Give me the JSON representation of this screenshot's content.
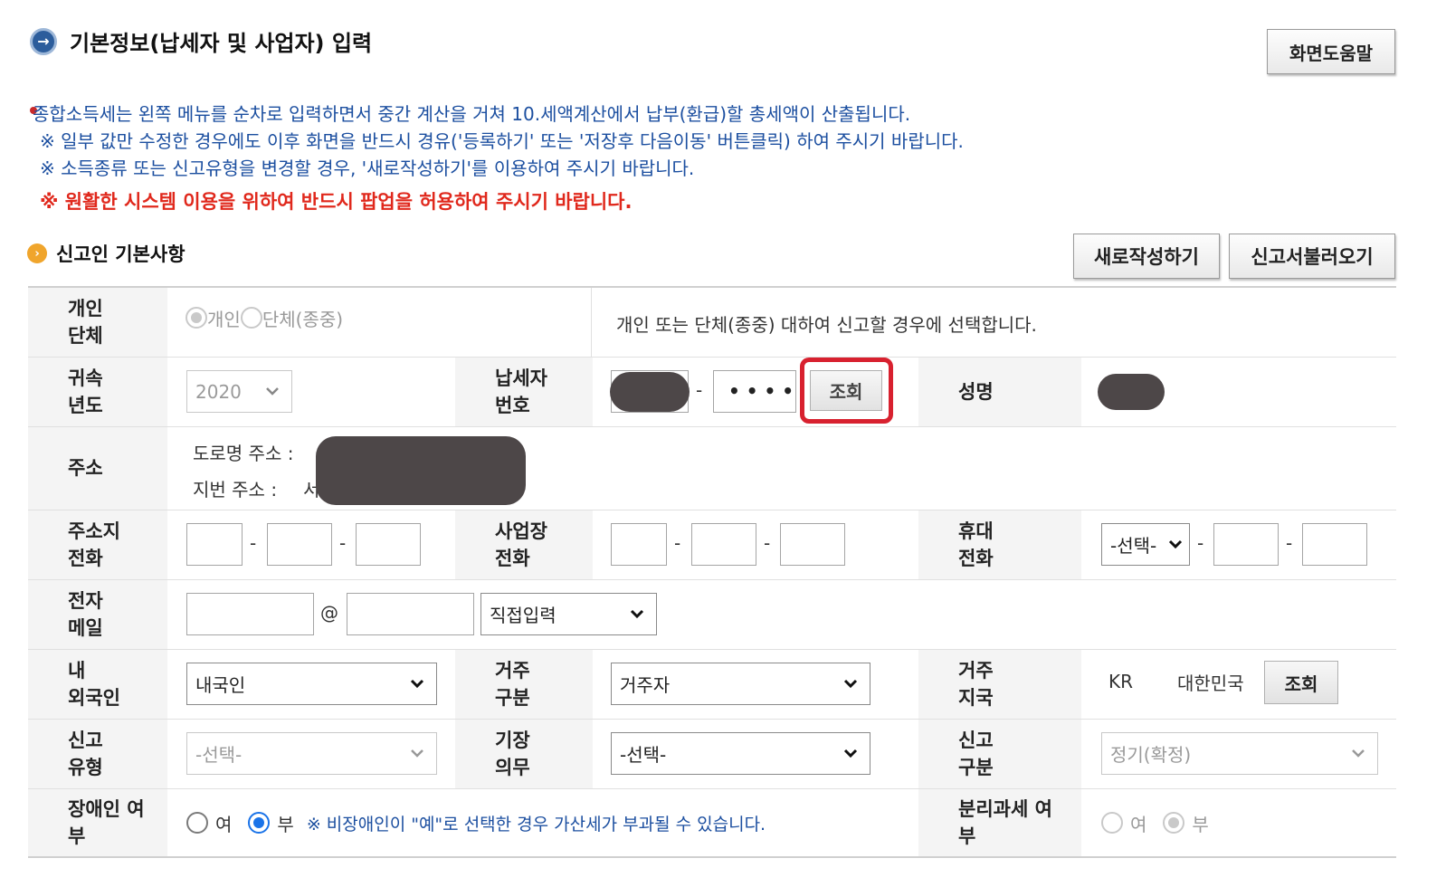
{
  "header": {
    "title": "기본정보(납세자 및 사업자) 입력",
    "help_button": "화면도움말"
  },
  "notices": {
    "line1": "종합소득세는 왼쪽 메뉴를 순차로 입력하면서 중간 계산을 거쳐 10.세액계산에서 납부(환급)할 총세액이 산출됩니다.",
    "line2": "※ 일부 값만 수정한 경우에도 이후 화면을 반드시 경유('등록하기' 또는 '저장후 다음이동' 버튼클릭) 하여 주시기 바랍니다.",
    "line3": "※ 소득종류 또는 신고유형을 변경할 경우, '새로작성하기'를 이용하여 주시기 바랍니다.",
    "warning": "※ 원활한 시스템 이용을 위하여 반드시 팝업을 허용하여 주시기 바랍니다."
  },
  "section": {
    "title": "신고인 기본사항",
    "new_button": "새로작성하기",
    "load_button": "신고서불러오기"
  },
  "form": {
    "type_label": "개인\n단체",
    "type_opt1": "개인",
    "type_opt2": "단체(종중)",
    "type_help": "개인 또는 단체(종중) 대하여 신고할 경우에 선택합니다.",
    "year_label": "귀속\n년도",
    "year_value": "2020",
    "taxid_label": "납세자\n번호",
    "taxid_mask": "• • • •",
    "taxid_search": "조회",
    "name_label": "성명",
    "addr_label": "주소",
    "addr_road": "도로명 주소 :",
    "addr_lot": "지번 주소 :",
    "addr_lot_value": "서",
    "home_phone_label": "주소지\n전화",
    "biz_phone_label": "사업장\n전화",
    "mobile_label": "휴대\n전화",
    "mobile_select": "-선택-",
    "email_label": "전자\n메일",
    "email_at": "@",
    "email_domain": "직접입력",
    "nationality_label": "내\n외국인",
    "nationality_value": "내국인",
    "residence_label": "거주\n구분",
    "residence_value": "거주자",
    "region_label": "거주\n지국",
    "region_code": "KR",
    "region_name": "대한민국",
    "region_search": "조회",
    "filing_type_label": "신고\n유형",
    "filing_type_value": "-선택-",
    "bookkeeping_label": "기장\n의무",
    "bookkeeping_value": "-선택-",
    "filing_class_label": "신고\n구분",
    "filing_class_value": "정기(확정)",
    "disabled_label": "장애인 여\n부",
    "yes": "여",
    "no": "부",
    "disabled_note": "※ 비장애인이 \"예\"로 선택한 경우 가산세가 부과될 수 있습니다.",
    "separate_tax_label": "분리과세 여\n부"
  }
}
